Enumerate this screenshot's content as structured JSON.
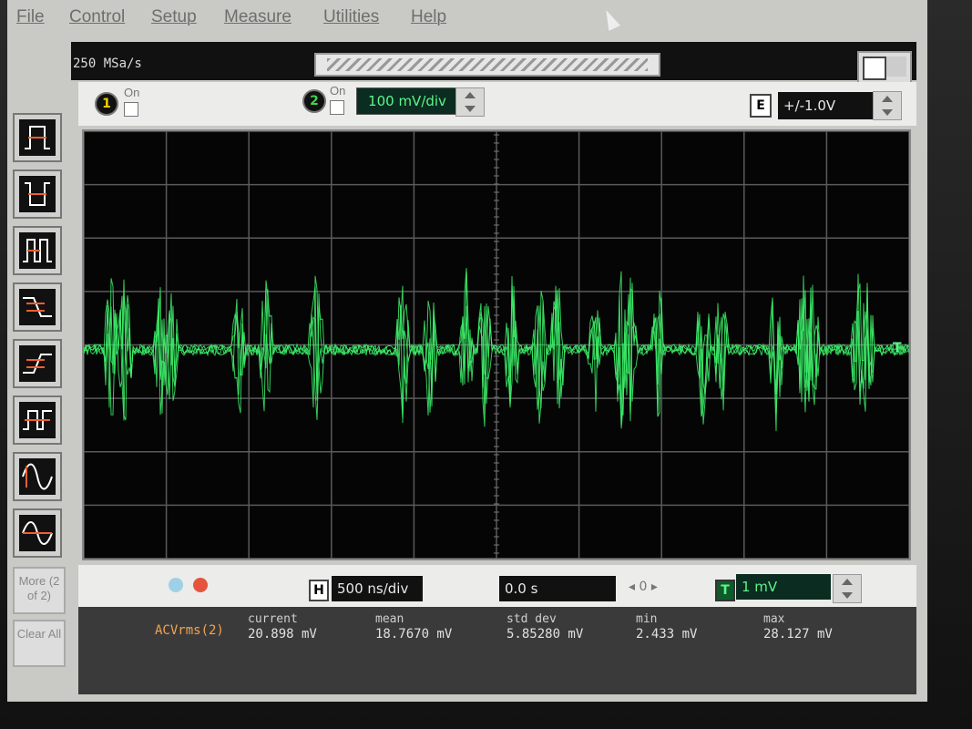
{
  "menu": {
    "items": [
      "File",
      "Control",
      "Setup",
      "Measure",
      "Utilities",
      "Help"
    ]
  },
  "status": {
    "sample_rate": "250 MSa/s"
  },
  "channels": {
    "ch1": {
      "number": "1",
      "on_label": "On"
    },
    "ch2": {
      "number": "2",
      "on_label": "On",
      "scale": "100 mV/div"
    }
  },
  "external": {
    "button": "E",
    "range": "+/-1.0V"
  },
  "sidebar": {
    "more_label": "More (2 of 2)",
    "clear_label": "Clear All"
  },
  "horizontal": {
    "button": "H",
    "time_div": "500 ns/div",
    "delay": "0.0 s",
    "delay_step": "0"
  },
  "trigger": {
    "button": "T",
    "level": "1 mV",
    "marker": "T"
  },
  "measurements": {
    "source": "ACVrms(2)",
    "columns": [
      {
        "label": "current",
        "value": "20.898 mV"
      },
      {
        "label": "mean",
        "value": "18.7670 mV"
      },
      {
        "label": "std dev",
        "value": "5.85280 mV"
      },
      {
        "label": "min",
        "value": "2.433 mV"
      },
      {
        "label": "max",
        "value": "28.127 mV"
      }
    ]
  },
  "colors": {
    "trace": "#3df06a",
    "grid": "#5a5a5a",
    "background": "#050505"
  }
}
